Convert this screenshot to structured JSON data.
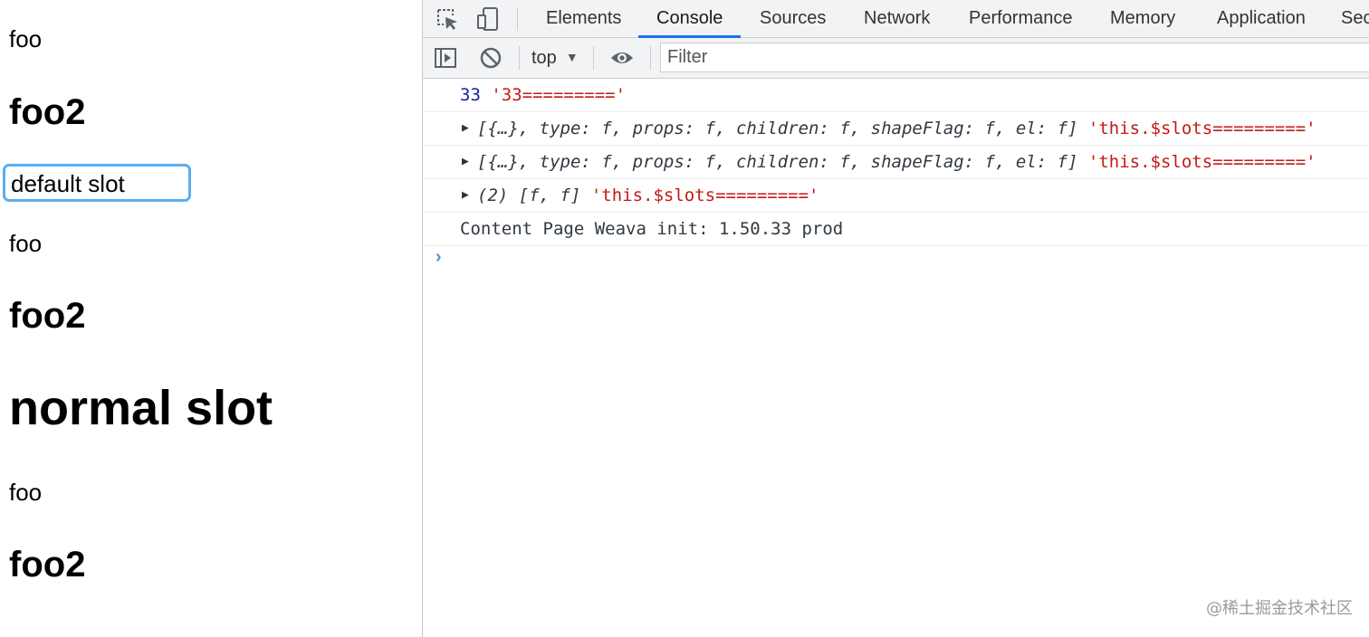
{
  "page": {
    "lines": [
      {
        "text": "foo",
        "style": "normal"
      },
      {
        "text": "foo2",
        "style": "heading"
      },
      {
        "text": "default slot",
        "style": "input"
      },
      {
        "text": "foo",
        "style": "normal"
      },
      {
        "text": "foo2",
        "style": "heading"
      },
      {
        "text": "normal slot",
        "style": "large-heading"
      },
      {
        "text": "foo",
        "style": "normal"
      },
      {
        "text": "foo2",
        "style": "heading"
      }
    ]
  },
  "devtools": {
    "tabs": [
      "Elements",
      "Console",
      "Sources",
      "Network",
      "Performance",
      "Memory",
      "Application",
      "Sec"
    ],
    "active_tab": "Console",
    "toolbar": {
      "context": "top",
      "filter_placeholder": "Filter"
    },
    "console": {
      "row1": {
        "num": "33",
        "str": "'33========='"
      },
      "row2": {
        "obj": "[{…}, type: f, props: f, children: f, shapeFlag: f, el: f]",
        "str": "'this.$slots========='"
      },
      "row3": {
        "obj": "[{…}, type: f, props: f, children: f, shapeFlag: f, el: f]",
        "str": "'this.$slots========='"
      },
      "row4": {
        "obj": "(2) [f, f]",
        "str": "'this.$slots========='"
      },
      "row5": {
        "text": "Content Page Weava init: 1.50.33 prod"
      },
      "prompt": "›"
    }
  },
  "watermark": "@稀土掘金技术社区",
  "colors": {
    "accent": "#1a73e8",
    "focus_border": "#5aaef0",
    "number": "#1a1aa6",
    "string": "#c41a16"
  }
}
